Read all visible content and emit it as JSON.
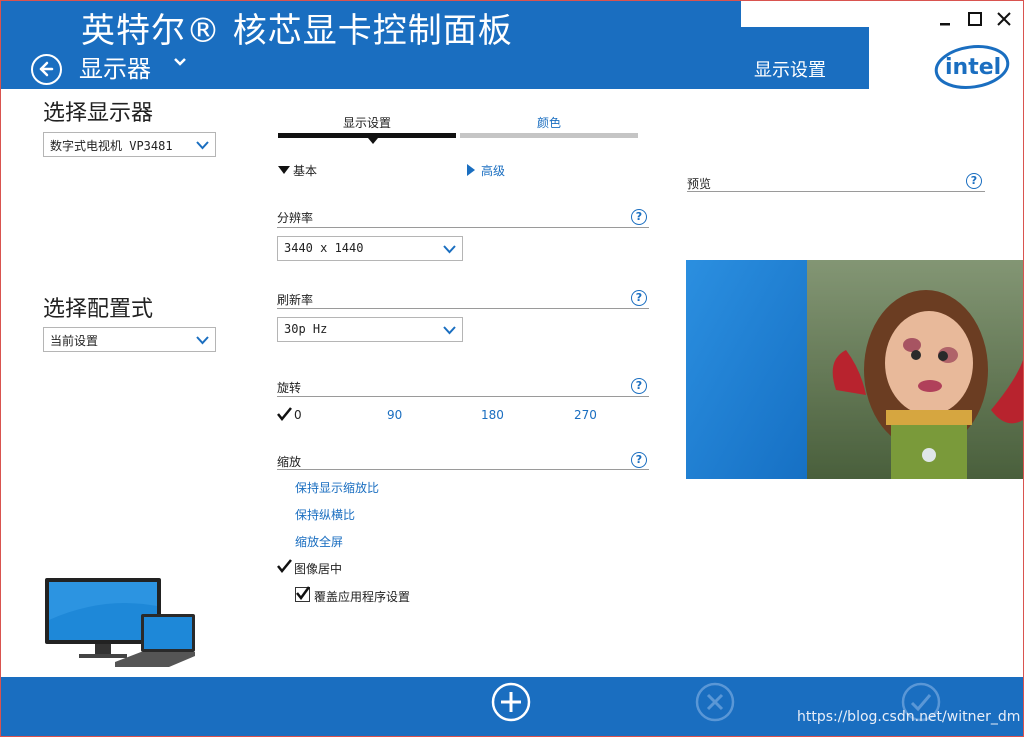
{
  "header": {
    "app_title": "英特尔® 核芯显卡控制面板",
    "page_title": "显示器",
    "section_tag": "显示设置",
    "logo_text": "intel",
    "window_controls": [
      "minimize-icon",
      "maximize-icon",
      "close-icon"
    ]
  },
  "left_panel": {
    "display_label": "选择显示器",
    "display_value": "数字式电视机 VP3481",
    "profile_label": "选择配置式",
    "profile_value": "当前设置"
  },
  "tabs": [
    {
      "label": "显示设置",
      "active": true
    },
    {
      "label": "颜色",
      "active": false
    }
  ],
  "modes": {
    "basic": "基本",
    "advanced": "高级"
  },
  "resolution": {
    "label": "分辨率",
    "value": "3440 x 1440"
  },
  "refresh": {
    "label": "刷新率",
    "value": "30p Hz"
  },
  "rotation": {
    "label": "旋转",
    "options": [
      "0",
      "90",
      "180",
      "270"
    ],
    "selected": "0"
  },
  "scaling": {
    "label": "缩放",
    "options": [
      "保持显示缩放比",
      "保持纵横比",
      "缩放全屏",
      "图像居中"
    ],
    "selected": "图像居中",
    "override_label": "覆盖应用程序设置",
    "override_checked": true
  },
  "preview": {
    "label": "预览"
  },
  "footer": {
    "buttons": [
      "add-icon",
      "cancel-icon",
      "apply-icon"
    ],
    "watermark": "https://blog.csdn.net/witner_dm"
  },
  "colors": {
    "brand_blue": "#1a6ec0",
    "link_blue": "#1a6ec0"
  }
}
